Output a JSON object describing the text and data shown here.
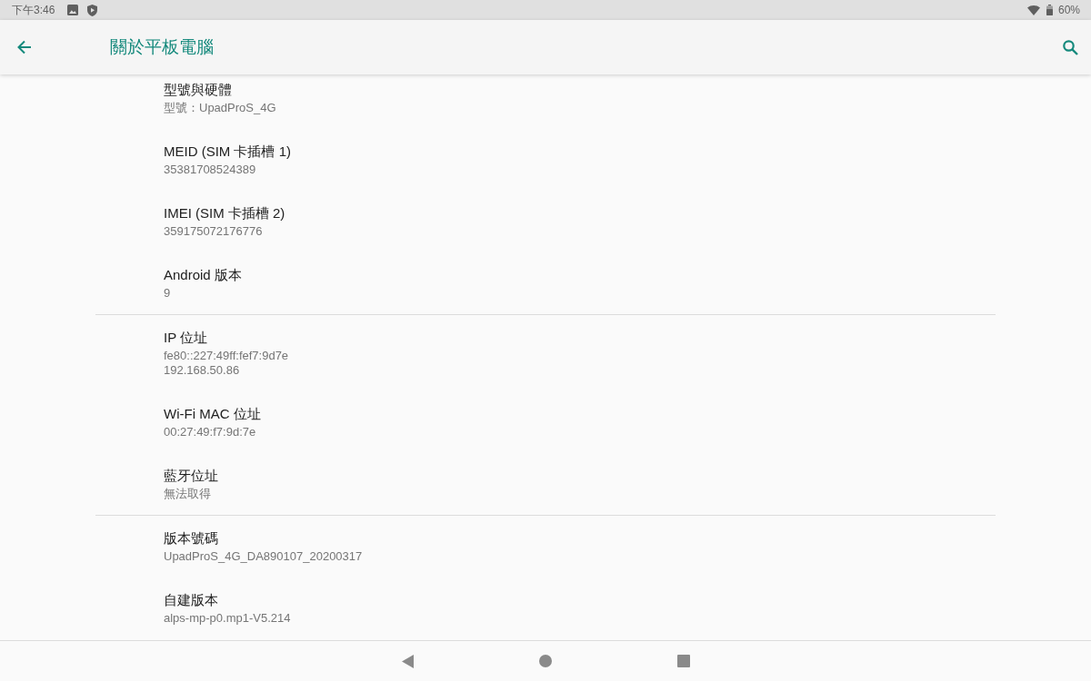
{
  "status_bar": {
    "time": "下午3:46",
    "battery": "60%"
  },
  "app_bar": {
    "title": "關於平板電腦"
  },
  "groups": [
    {
      "items": [
        {
          "title": "型號與硬體",
          "summary": "型號：UpadProS_4G"
        },
        {
          "title": "MEID (SIM 卡插槽 1)",
          "summary": "35381708524389"
        },
        {
          "title": "IMEI (SIM 卡插槽 2)",
          "summary": "359175072176776"
        },
        {
          "title": "Android 版本",
          "summary": "9"
        }
      ]
    },
    {
      "items": [
        {
          "title": "IP 位址",
          "summary": "fe80::227:49ff:fef7:9d7e\n192.168.50.86"
        },
        {
          "title": "Wi-Fi MAC 位址",
          "summary": "00:27:49:f7:9d:7e"
        },
        {
          "title": "藍牙位址",
          "summary": "無法取得"
        }
      ]
    },
    {
      "items": [
        {
          "title": "版本號碼",
          "summary": "UpadProS_4G_DA890107_20200317"
        },
        {
          "title": "自建版本",
          "summary": "alps-mp-p0.mp1-V5.214"
        }
      ]
    }
  ]
}
